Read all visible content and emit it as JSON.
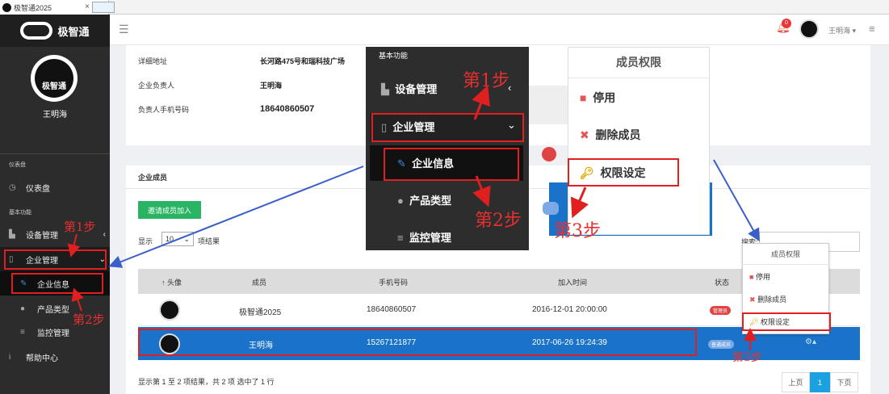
{
  "browser": {
    "tab_title": "极智通2025",
    "tab_close": "×"
  },
  "brand": {
    "name": "极智通"
  },
  "sidebar": {
    "logo_caption": "极智通",
    "user_name": "王明海",
    "sections": [
      {
        "heading": "仪表盘",
        "items": [
          {
            "label": "仪表盘",
            "icon": "dashboard-icon"
          }
        ]
      },
      {
        "heading": "基本功能",
        "items": [
          {
            "label": "设备管理",
            "icon": "chart-icon",
            "chevron": "‹"
          },
          {
            "label": "企业管理",
            "icon": "building-icon",
            "chevron": "⌄"
          },
          {
            "label": "企业信息",
            "icon": "edit-icon"
          },
          {
            "label": "产品类型",
            "icon": "product-icon"
          },
          {
            "label": "监控管理",
            "icon": "database-icon"
          },
          {
            "label": "帮助中心",
            "icon": "info-icon"
          }
        ]
      }
    ]
  },
  "header": {
    "notification_count": "0",
    "user_name": "王明海",
    "user_caret": "▾"
  },
  "company_info": [
    {
      "label": "详细地址",
      "value": "长河路475号和瑞科技广场"
    },
    {
      "label": "企业负责人",
      "value": "王明海"
    },
    {
      "label": "负责人手机号码",
      "value": "18640860507"
    }
  ],
  "members": {
    "title": "企业成员",
    "invite_label": "邀请成员加入",
    "show_label": "显示",
    "page_size": "10",
    "records_label": "项结果",
    "search_label": "搜索:",
    "columns": [
      "↑ 头像",
      "成员",
      "手机号码",
      "加入时间",
      "状态"
    ],
    "rows": [
      {
        "name": "极智通2025",
        "phone": "18640860507",
        "joined": "2016-12-01 20:00:00",
        "status": "管理员"
      },
      {
        "name": "王明海",
        "phone": "15267121877",
        "joined": "2017-06-26 19:24:39",
        "status": "普通成员"
      }
    ],
    "footer": "显示第 1 至 2 项结果，共 2 项  选中了 1 行",
    "pagination": {
      "prev": "上页",
      "current": "1",
      "next": "下页"
    }
  },
  "permission_menu": {
    "title": "成员权限",
    "items": [
      {
        "label": "停用",
        "icon": "stop-icon"
      },
      {
        "label": "删除成员",
        "icon": "delete-icon"
      },
      {
        "label": "权限设定",
        "icon": "key-icon"
      }
    ]
  },
  "menu_zoom": {
    "heading": "基本功能",
    "items": [
      "设备管理",
      "企业管理",
      "企业信息",
      "产品类型",
      "监控管理"
    ],
    "chevrons": [
      "‹",
      "⌄"
    ]
  },
  "annotations": {
    "step1": "第1步",
    "step2": "第2步",
    "step3": "第3步"
  },
  "colors": {
    "accent_blue": "#1a73c8",
    "annotation_red": "#e02020",
    "invite_green": "#28b463",
    "sidebar_dark": "#2c2c2c"
  }
}
